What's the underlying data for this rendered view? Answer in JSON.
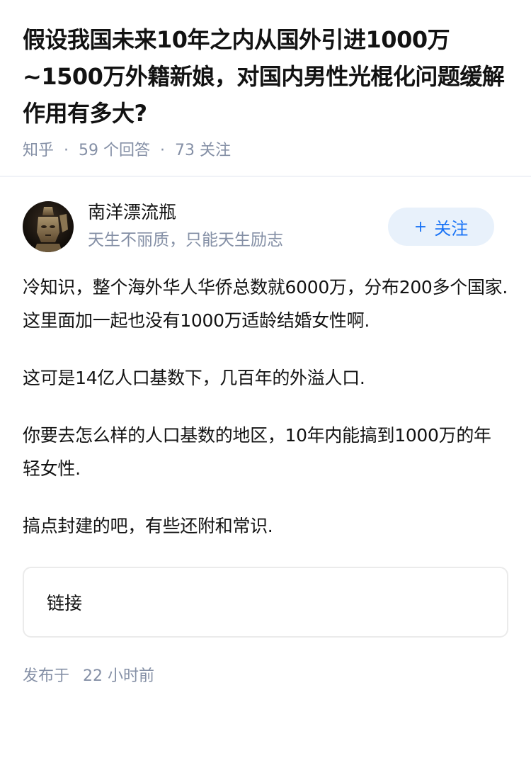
{
  "question": {
    "title": "假设我国未来10年之内从国外引进1000万~1500万外籍新娘，对国内男性光棍化问题缓解作用有多大?",
    "source": "知乎",
    "answers_count": "59 个回答",
    "followers_count": "73 关注",
    "separator": "·"
  },
  "author": {
    "name": "南洋漂流瓶",
    "bio": "天生不丽质，只能天生励志",
    "follow_plus": "+",
    "follow_label": "关注"
  },
  "answer": {
    "paragraphs": [
      "冷知识，整个海外华人华侨总数就6000万，分布200多个国家.这里面加一起也没有1000万适龄结婚女性啊.",
      "这可是14亿人口基数下，几百年的外溢人口.",
      "你要去怎么样的人口基数的地区，10年内能搞到1000万的年轻女性.",
      "搞点封建的吧，有些还附和常识."
    ],
    "link_label": "链接",
    "published_prefix": "发布于",
    "published_time": "22 小时前"
  },
  "colors": {
    "accent": "#1772f6",
    "follow_bg": "#e8f1fb",
    "meta_gray": "#8590a6"
  }
}
